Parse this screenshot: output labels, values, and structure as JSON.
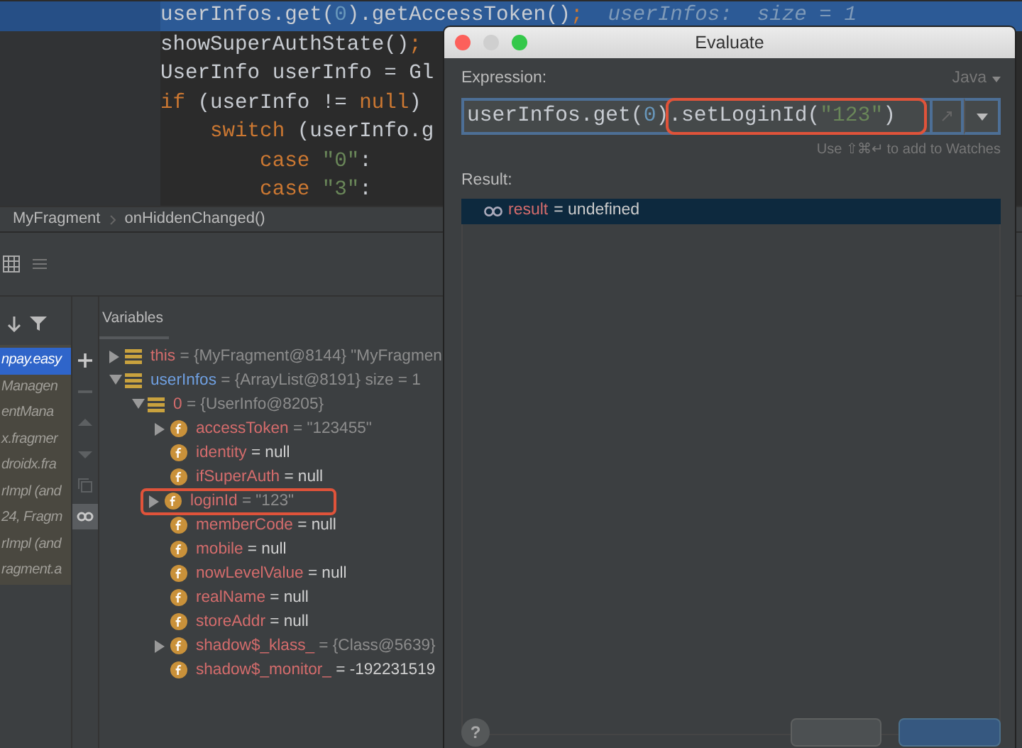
{
  "editor": {
    "lines": [
      {
        "selected": true,
        "tokens": [
          {
            "kind": "plain",
            "text": "userInfos.get("
          },
          {
            "kind": "number",
            "text": "0"
          },
          {
            "kind": "plain",
            "text": ").getAccessToken()"
          },
          {
            "kind": "keyword",
            "text": ";"
          },
          {
            "kind": "comment",
            "text": "  userInfos:  size = 1"
          }
        ]
      },
      {
        "selected": false,
        "tokens": [
          {
            "kind": "plain",
            "text": "showSuperAuthState()"
          },
          {
            "kind": "keyword",
            "text": ";"
          }
        ]
      },
      {
        "selected": false,
        "tokens": [
          {
            "kind": "plain",
            "text": "UserInfo userInfo = Gl"
          }
        ]
      },
      {
        "selected": false,
        "tokens": [
          {
            "kind": "keyword",
            "text": "if"
          },
          {
            "kind": "plain",
            "text": " (userInfo != "
          },
          {
            "kind": "keyword",
            "text": "null"
          },
          {
            "kind": "plain",
            "text": ")"
          }
        ]
      },
      {
        "selected": false,
        "tokens": [
          {
            "kind": "keyword",
            "text": "    switch"
          },
          {
            "kind": "plain",
            "text": " (userInfo.g"
          }
        ]
      },
      {
        "selected": false,
        "tokens": [
          {
            "kind": "keyword",
            "text": "        case"
          },
          {
            "kind": "string",
            "text": " \"0\""
          },
          {
            "kind": "plain",
            "text": ":"
          }
        ]
      },
      {
        "selected": false,
        "tokens": [
          {
            "kind": "keyword",
            "text": "        case"
          },
          {
            "kind": "string",
            "text": " \"3\""
          },
          {
            "kind": "plain",
            "text": ":"
          }
        ]
      }
    ]
  },
  "breadcrumbs": [
    "MyFragment",
    "onHiddenChanged()"
  ],
  "debugger": {
    "frames": [
      {
        "text": "npay.easy",
        "selected": true
      },
      {
        "text": "Managen",
        "selected": false
      },
      {
        "text": "entMana",
        "selected": false
      },
      {
        "text": "x.fragmer",
        "selected": false
      },
      {
        "text": "droidx.fra",
        "selected": false
      },
      {
        "text": "rImpl (and",
        "selected": false
      },
      {
        "text": "24, Fragm",
        "selected": false
      },
      {
        "text": "rImpl (and",
        "selected": false
      },
      {
        "text": "ragment.a",
        "selected": false
      }
    ],
    "side_tools": [
      {
        "kind": "add",
        "disabled": false,
        "on": false
      },
      {
        "kind": "remove",
        "disabled": true,
        "on": false
      },
      {
        "kind": "up",
        "disabled": true,
        "on": false
      },
      {
        "kind": "down",
        "disabled": true,
        "on": false
      },
      {
        "kind": "copy",
        "disabled": true,
        "on": false
      },
      {
        "kind": "watches",
        "disabled": false,
        "on": true
      }
    ],
    "tabs": [
      {
        "label": "Variables",
        "selected": true
      }
    ],
    "variables": [
      {
        "kind": "object",
        "name": "this",
        "changed": false,
        "value": "= {MyFragment@8144} \"MyFragmen",
        "is_reference": true,
        "expandable": true,
        "expanded": false,
        "highlighted": false
      },
      {
        "kind": "object",
        "name": "userInfos",
        "changed": true,
        "value": "= {ArrayList@8191}  size = 1",
        "is_reference": true,
        "expandable": true,
        "expanded": true,
        "highlighted": false,
        "children": [
          {
            "kind": "object",
            "name": "0",
            "changed": false,
            "value": "= {UserInfo@8205}",
            "is_reference": true,
            "expandable": true,
            "expanded": true,
            "highlighted": false,
            "children": [
              {
                "kind": "field",
                "name": "accessToken",
                "changed": false,
                "value": "= \"123455\"",
                "is_reference": true,
                "expandable": true,
                "expanded": false,
                "highlighted": false
              },
              {
                "kind": "field",
                "name": "identity",
                "changed": false,
                "value": "= null",
                "is_reference": false,
                "expandable": false,
                "highlighted": false
              },
              {
                "kind": "field",
                "name": "ifSuperAuth",
                "changed": false,
                "value": "= null",
                "is_reference": false,
                "expandable": false,
                "highlighted": false
              },
              {
                "kind": "field",
                "name": "loginId",
                "changed": false,
                "value": "= \"123\"",
                "is_reference": true,
                "expandable": true,
                "expanded": false,
                "highlighted": true
              },
              {
                "kind": "field",
                "name": "memberCode",
                "changed": false,
                "value": "= null",
                "is_reference": false,
                "expandable": false,
                "highlighted": false
              },
              {
                "kind": "field",
                "name": "mobile",
                "changed": false,
                "value": "= null",
                "is_reference": false,
                "expandable": false,
                "highlighted": false
              },
              {
                "kind": "field",
                "name": "nowLevelValue",
                "changed": false,
                "value": "= null",
                "is_reference": false,
                "expandable": false,
                "highlighted": false
              },
              {
                "kind": "field",
                "name": "realName",
                "changed": false,
                "value": "= null",
                "is_reference": false,
                "expandable": false,
                "highlighted": false
              },
              {
                "kind": "field",
                "name": "storeAddr",
                "changed": false,
                "value": "= null",
                "is_reference": false,
                "expandable": false,
                "highlighted": false
              },
              {
                "kind": "field",
                "name": "shadow$_klass_",
                "changed": false,
                "value": "= {Class@5639}",
                "is_reference": true,
                "expandable": true,
                "expanded": false,
                "highlighted": false
              },
              {
                "kind": "field",
                "name": "shadow$_monitor_",
                "changed": false,
                "value": "= -192231519",
                "is_reference": false,
                "expandable": false,
                "highlighted": false
              }
            ]
          }
        ]
      }
    ]
  },
  "dialog": {
    "title": "Evaluate",
    "expression_label": "Expression:",
    "language": "Java",
    "expression": [
      {
        "text": "userInfos.get(",
        "highlighted": false,
        "kind": "plain"
      },
      {
        "text": "0",
        "highlighted": false,
        "kind": "number"
      },
      {
        "text": ")",
        "highlighted": false,
        "kind": "plain"
      },
      {
        "text": ".setLoginId(",
        "highlighted": true,
        "kind": "plain"
      },
      {
        "text": "\"123\"",
        "highlighted": true,
        "kind": "string"
      },
      {
        "text": ")",
        "highlighted": true,
        "kind": "plain"
      }
    ],
    "hint": "Use ⇧⌘↵ to add to Watches",
    "result_label": "Result:",
    "result": {
      "name": "result",
      "value": "= undefined",
      "selected": true
    },
    "help": "?",
    "buttons": [
      {
        "default": false
      },
      {
        "default": true
      }
    ]
  }
}
